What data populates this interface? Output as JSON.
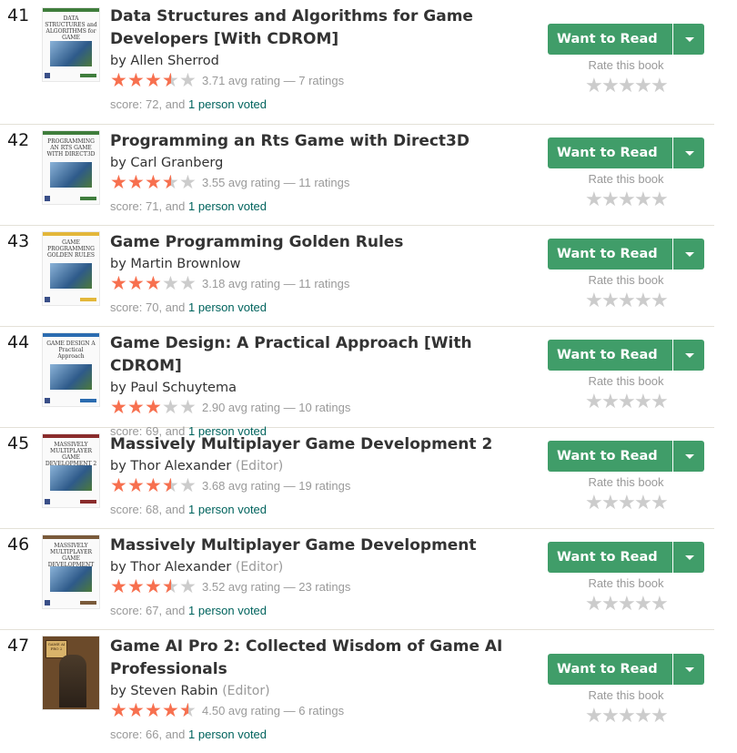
{
  "rate_label": "Rate this book",
  "want_to_read_label": "Want to Read",
  "colors": {
    "accent_green": "#409d69",
    "star_filled": "#f7704f",
    "star_empty": "#cccccc",
    "link": "#00635d"
  },
  "books": [
    {
      "rank": "41",
      "title": "Data Structures and Algorithms for Game Developers [With CDROM]",
      "author": "Allen Sherrod",
      "role": "",
      "stars": 3.71,
      "rating_text": "3.71 avg rating — 7 ratings",
      "score_text": "score: 72, and",
      "voters_text": "1 person voted",
      "cover_text": "DATA STRUCTURES and ALGORITHMS for GAME DEVELOPERS",
      "cover_color": "#3f7d3c"
    },
    {
      "rank": "42",
      "title": "Programming an Rts Game with Direct3D",
      "author": "Carl Granberg",
      "role": "",
      "stars": 3.55,
      "rating_text": "3.55 avg rating — 11 ratings",
      "score_text": "score: 71, and",
      "voters_text": "1 person voted",
      "cover_text": "PROGRAMMING AN RTS GAME WITH DIRECT3D",
      "cover_color": "#3f7d3c"
    },
    {
      "rank": "43",
      "title": "Game Programming Golden Rules",
      "author": "Martin Brownlow",
      "role": "",
      "stars": 3.18,
      "rating_text": "3.18 avg rating — 11 ratings",
      "score_text": "score: 70, and",
      "voters_text": "1 person voted",
      "cover_text": "GAME PROGRAMMING GOLDEN RULES",
      "cover_color": "#e3b73a"
    },
    {
      "rank": "44",
      "title": "Game Design: A Practical Approach [With CDROM]",
      "author": "Paul Schuytema",
      "role": "",
      "stars": 2.9,
      "rating_text": "2.90 avg rating — 10 ratings",
      "score_text": "score: 69, and",
      "voters_text": "1 person voted",
      "cover_text": "GAME DESIGN A Practical Approach",
      "cover_color": "#2b6cb0"
    },
    {
      "rank": "45",
      "title": "Massively Multiplayer Game Development 2",
      "author": "Thor Alexander",
      "role": "(Editor)",
      "stars": 3.68,
      "rating_text": "3.68 avg rating — 19 ratings",
      "score_text": "score: 68, and",
      "voters_text": "1 person voted",
      "cover_text": "MASSIVELY MULTIPLAYER GAME DEVELOPMENT 2",
      "cover_color": "#8a2c2c"
    },
    {
      "rank": "46",
      "title": "Massively Multiplayer Game Development",
      "author": "Thor Alexander",
      "role": "(Editor)",
      "stars": 3.52,
      "rating_text": "3.52 avg rating — 23 ratings",
      "score_text": "score: 67, and",
      "voters_text": "1 person voted",
      "cover_text": "MASSIVELY MULTIPLAYER GAME DEVELOPMENT",
      "cover_color": "#7a5a3a"
    },
    {
      "rank": "47",
      "title": "Game AI Pro 2: Collected Wisdom of Game AI Professionals",
      "author": "Steven Rabin",
      "role": "(Editor)",
      "stars": 4.5,
      "rating_text": "4.50 avg rating — 6 ratings",
      "score_text": "score: 66, and",
      "voters_text": "1 person voted",
      "cover_text": "GAME AI PRO 2",
      "cover_color": "#6b4a2a"
    }
  ]
}
